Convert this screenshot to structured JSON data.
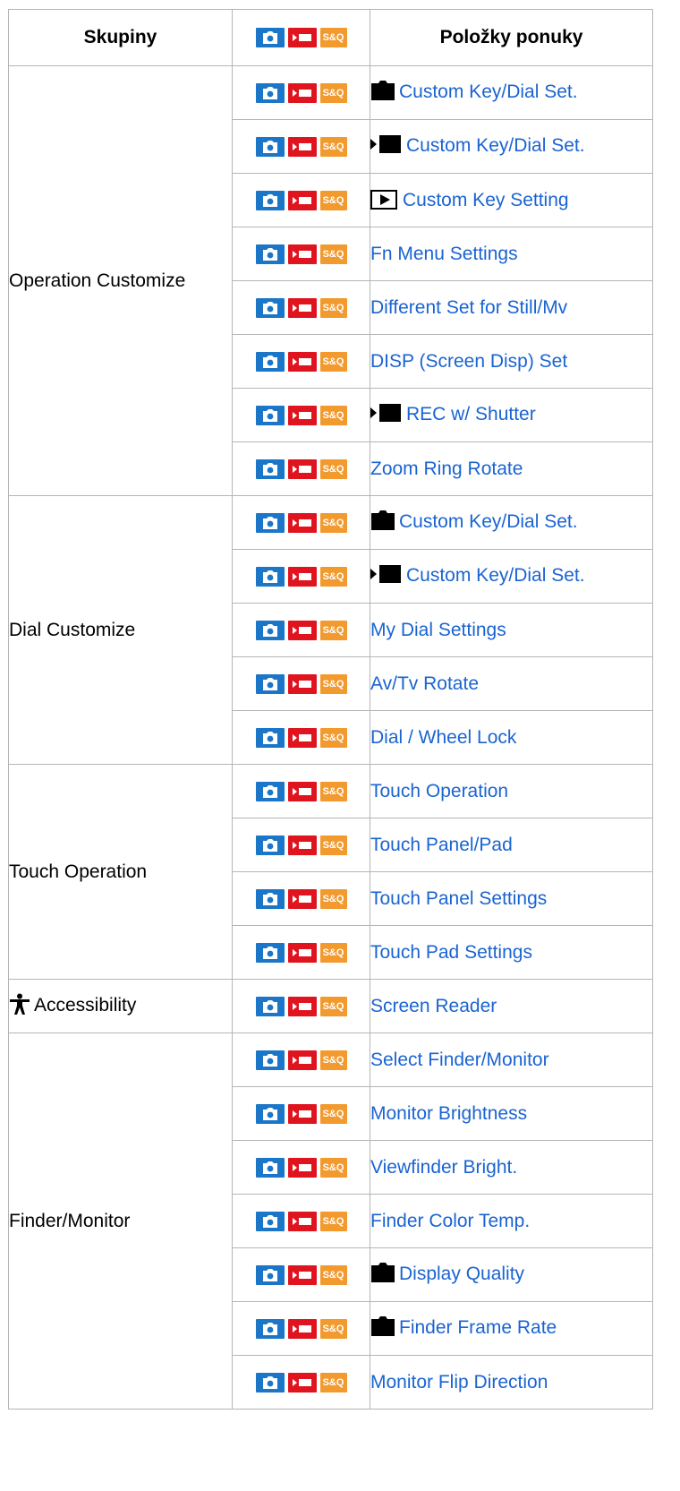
{
  "header": {
    "col_groups": "Skupiny",
    "col_items": "Položky ponuky",
    "modes_badge": {
      "photo_icon": "camera-icon",
      "movie_icon": "movie-icon",
      "sq_label": "S&Q"
    }
  },
  "colors": {
    "photo": "#1b76c8",
    "movie": "#e0141e",
    "sq": "#f29a2e",
    "link": "#1a64d2"
  },
  "groups": [
    {
      "name": "Operation Customize",
      "items": [
        {
          "label": "Custom Key/Dial Set.",
          "prefix_icon": "still-camera-icon"
        },
        {
          "label": "Custom Key/Dial Set.",
          "prefix_icon": "movie-mode-icon"
        },
        {
          "label": "Custom Key Setting",
          "prefix_icon": "playback-icon"
        },
        {
          "label": "Fn Menu Settings"
        },
        {
          "label": "Different Set for Still/Mv"
        },
        {
          "label": "DISP (Screen Disp) Set"
        },
        {
          "label": "REC w/ Shutter",
          "prefix_icon": "movie-mode-icon"
        },
        {
          "label": "Zoom Ring Rotate"
        }
      ]
    },
    {
      "name": "Dial Customize",
      "items": [
        {
          "label": "Custom Key/Dial Set.",
          "prefix_icon": "still-camera-icon"
        },
        {
          "label": "Custom Key/Dial Set.",
          "prefix_icon": "movie-mode-icon"
        },
        {
          "label": "My Dial Settings"
        },
        {
          "label": "Av/Tv Rotate"
        },
        {
          "label": "Dial / Wheel Lock"
        }
      ]
    },
    {
      "name": "Touch Operation",
      "items": [
        {
          "label": "Touch Operation"
        },
        {
          "label": "Touch Panel/Pad"
        },
        {
          "label": "Touch Panel Settings"
        },
        {
          "label": "Touch Pad Settings"
        }
      ]
    },
    {
      "name": "Accessibility",
      "name_icon": "accessibility-icon",
      "items": [
        {
          "label": "Screen Reader"
        }
      ]
    },
    {
      "name": "Finder/Monitor",
      "items": [
        {
          "label": "Select Finder/Monitor"
        },
        {
          "label": "Monitor Brightness"
        },
        {
          "label": "Viewfinder Bright."
        },
        {
          "label": "Finder Color Temp."
        },
        {
          "label": "Display Quality",
          "prefix_icon": "still-camera-icon"
        },
        {
          "label": "Finder Frame Rate",
          "prefix_icon": "still-camera-icon"
        },
        {
          "label": "Monitor Flip Direction"
        }
      ]
    }
  ]
}
